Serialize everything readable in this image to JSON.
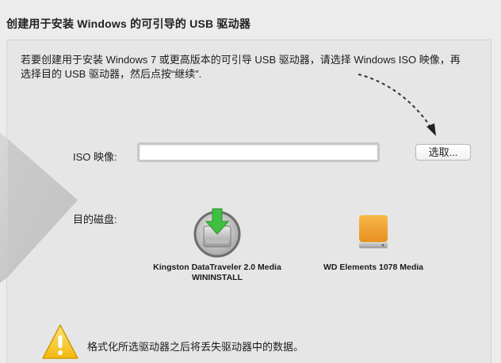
{
  "window": {
    "title": "创建用于安装 Windows 的可引导的 USB 驱动器"
  },
  "intro": {
    "text": "若要创建用于安装 Windows 7 或更高版本的可引导 USB 驱动器，请选择 Windows ISO 映像，再选择目的 USB 驱动器，然后点按“继续”."
  },
  "iso": {
    "label": "ISO 映像:",
    "value": "",
    "choose_label": "选取..."
  },
  "disk": {
    "label": "目的磁盘:",
    "drives": [
      {
        "name": "Kingston DataTraveler 2.0 Media",
        "volume": "WININSTALL",
        "selected": true,
        "icon": "usb-drive-download-icon"
      },
      {
        "name": "WD Elements 1078 Media",
        "volume": "",
        "selected": false,
        "icon": "external-drive-icon"
      }
    ]
  },
  "warning": {
    "icon": "warning-icon",
    "text": "格式化所选驱动器之后将丢失驱动器中的数据。"
  },
  "colors": {
    "background": "#ececec",
    "panel": "#e6e6e6",
    "download_arrow": "#3fbf3f",
    "wd_drive": "#f0a32a",
    "warning": "#f5c518"
  }
}
